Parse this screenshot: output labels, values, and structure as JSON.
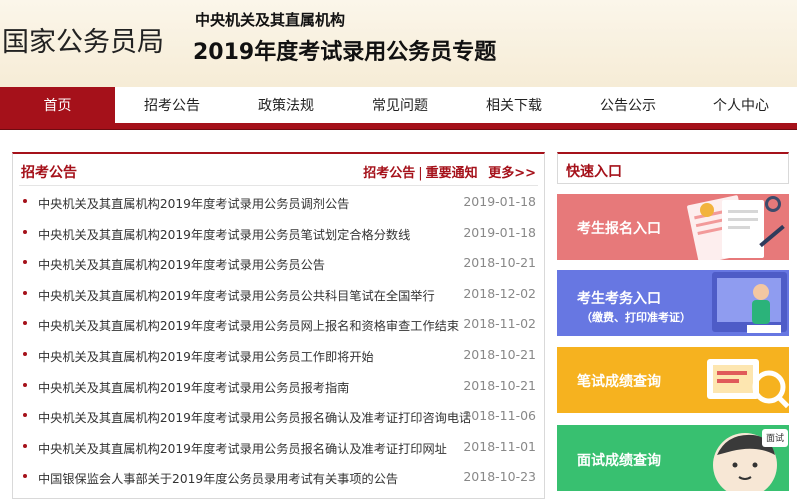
{
  "header": {
    "org_name": "国家公务员局",
    "subtitle": "中央机关及其直属机构",
    "title": "2019年度考试录用公务员专题"
  },
  "nav": {
    "items": [
      "首页",
      "招考公告",
      "政策法规",
      "常见问题",
      "相关下载",
      "公告公示",
      "个人中心"
    ],
    "active": "首页"
  },
  "news": {
    "section_title": "招考公告",
    "links": [
      "招考公告",
      "重要通知",
      "更多>>"
    ],
    "items": [
      {
        "title": "中央机关及其直属机构2019年度考试录用公务员调剂公告",
        "date": "2019-01-18"
      },
      {
        "title": "中央机关及其直属机构2019年度考试录用公务员笔试划定合格分数线",
        "date": "2019-01-18"
      },
      {
        "title": "中央机关及其直属机构2019年度考试录用公务员公告",
        "date": "2018-10-21"
      },
      {
        "title": "中央机关及其直属机构2019年度考试录用公务员公共科目笔试在全国举行",
        "date": "2018-12-02"
      },
      {
        "title": "中央机关及其直属机构2019年度考试录用公务员网上报名和资格审查工作结束",
        "date": "2018-11-02"
      },
      {
        "title": "中央机关及其直属机构2019年度考试录用公务员工作即将开始",
        "date": "2018-10-21"
      },
      {
        "title": "中央机关及其直属机构2019年度考试录用公务员报考指南",
        "date": "2018-10-21"
      },
      {
        "title": "中央机关及其直属机构2019年度考试录用公务员报名确认及准考证打印咨询电话",
        "date": "2018-11-06"
      },
      {
        "title": "中央机关及其直属机构2019年度考试录用公务员报名确认及准考证打印网址",
        "date": "2018-11-01"
      },
      {
        "title": "中国银保监会人事部关于2019年度公务员录用考试有关事项的公告",
        "date": "2018-10-23"
      }
    ]
  },
  "quick": {
    "title": "快速入口",
    "cards": [
      {
        "label": "考生报名入口",
        "sub": "",
        "color": "#e7797a"
      },
      {
        "label": "考生考务入口",
        "sub": "（缴费、打印准考证）",
        "color": "#6777e2"
      },
      {
        "label": "笔试成绩查询",
        "sub": "",
        "color": "#f6b21f"
      },
      {
        "label": "面试成绩查询",
        "sub": "",
        "color": "#38c070"
      }
    ],
    "badge_text": "面试"
  },
  "colors": {
    "brand_red": "#a5111a"
  }
}
